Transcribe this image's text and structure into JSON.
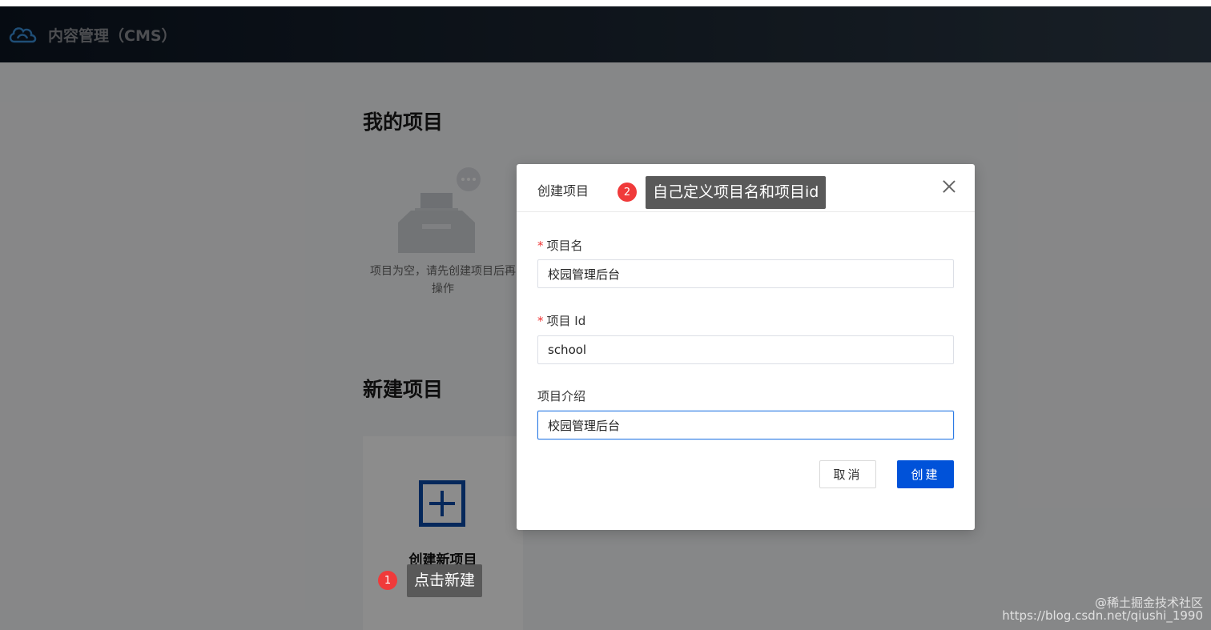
{
  "header": {
    "app_title": "内容管理（CMS）",
    "logo_icon": "cloud-icon"
  },
  "my_projects": {
    "title": "我的项目",
    "empty_text_line1": "项目为空，请先创建项目后再",
    "empty_text_line2": "操作"
  },
  "new_project": {
    "title": "新建项目",
    "card_label": "创建新项目"
  },
  "dialog": {
    "title": "创建项目",
    "fields": [
      {
        "label": "项目名",
        "required": true,
        "value": "校园管理后台"
      },
      {
        "label": "项目 Id",
        "required": true,
        "value": "school"
      },
      {
        "label": "项目介绍",
        "required": false,
        "value": "校园管理后台"
      }
    ],
    "cancel_label": "取消",
    "create_label": "创建"
  },
  "annotations": [
    {
      "number": "1",
      "text": "点击新建"
    },
    {
      "number": "2",
      "text": "自己定义项目名和项目id"
    }
  ],
  "watermark": {
    "line1": "@稀土掘金技术社区",
    "line2": "https://blog.csdn.net/qiushi_1990"
  },
  "colors": {
    "primary": "#0052d9",
    "badge": "#f03a3a",
    "header_bg": "#1f2a36"
  }
}
